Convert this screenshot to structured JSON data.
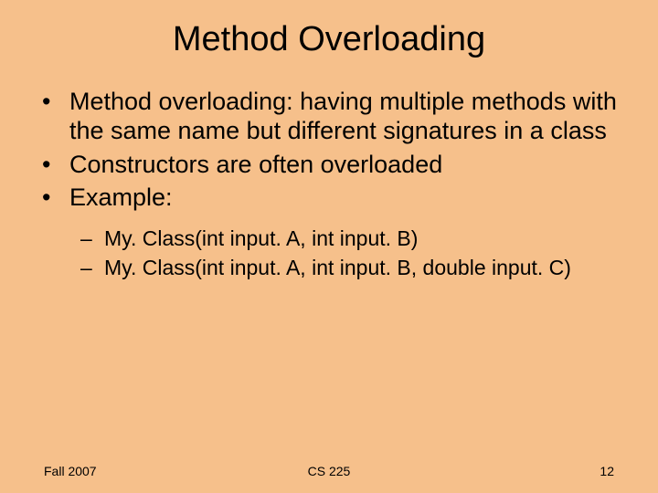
{
  "title": "Method Overloading",
  "bullets": [
    "Method overloading: having multiple methods with the same name but different signatures in a class",
    "Constructors are often overloaded",
    "Example:"
  ],
  "sub_bullets": [
    "My. Class(int input. A, int input. B)",
    "My. Class(int input. A, int input. B, double input. C)"
  ],
  "footer": {
    "left": "Fall 2007",
    "center": "CS 225",
    "right": "12"
  }
}
